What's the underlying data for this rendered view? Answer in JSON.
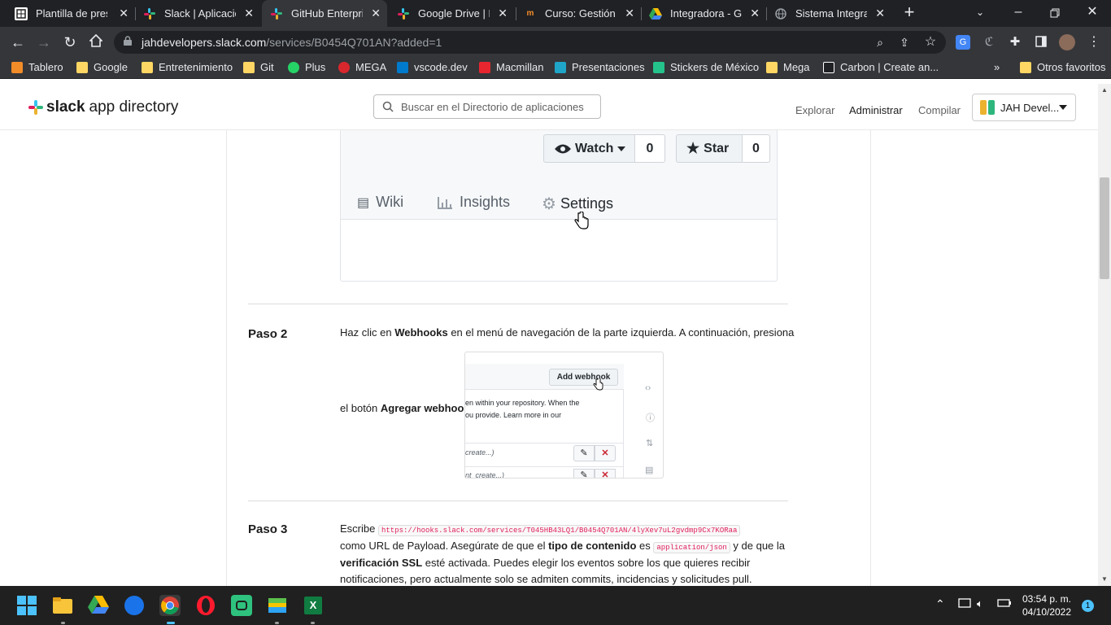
{
  "tabs": [
    {
      "title": "Plantilla de presu",
      "icon": "sheets-icon",
      "color": "#ffffff"
    },
    {
      "title": "Slack | Aplicacion",
      "icon": "slack-icon",
      "color": "#e01e5a"
    },
    {
      "title": "GitHub Enterprise",
      "icon": "slack-icon",
      "color": "#36c5f0"
    },
    {
      "title": "Google Drive | Di",
      "icon": "slack-icon",
      "color": "#ecb22e"
    },
    {
      "title": "Curso: Gestión de",
      "icon": "course-icon",
      "color": "#f28c28"
    },
    {
      "title": "Integradora - Go",
      "icon": "drive-icon",
      "color": "#34a853"
    },
    {
      "title": "Sistema Integral",
      "icon": "globe-icon",
      "color": "#9aa0a6"
    }
  ],
  "address": {
    "domain": "jahdevelopers.slack.com",
    "path": "/services/B0454Q701AN?added=1"
  },
  "bookmarks": [
    {
      "label": "Tablero",
      "color": "#f28c28"
    },
    {
      "label": "Google",
      "color": "#fdd663"
    },
    {
      "label": "Entretenimiento",
      "color": "#fdd663"
    },
    {
      "label": "Git",
      "color": "#fdd663"
    },
    {
      "label": "Plus",
      "color": "#25d366"
    },
    {
      "label": "MEGA",
      "color": "#d9272e"
    },
    {
      "label": "vscode.dev",
      "color": "#007acc"
    },
    {
      "label": "Macmillan",
      "color": "#e8262f"
    },
    {
      "label": "Presentaciones",
      "color": "#1fa5c8"
    },
    {
      "label": "Stickers de México",
      "color": "#24c38b"
    },
    {
      "label": "Mega",
      "color": "#fdd663"
    },
    {
      "label": "Carbon | Create an...",
      "color": "#ffffff"
    }
  ],
  "other_bookmarks": "Otros favoritos",
  "site": {
    "logo_bold": "slack",
    "logo_rest": "app directory",
    "search_placeholder": "Buscar en el Directorio de aplicaciones",
    "nav": [
      "Explorar",
      "Administrar",
      "Compilar"
    ],
    "workspace": "JAH Devel..."
  },
  "github": {
    "watch_label": "Watch",
    "watch_count": "0",
    "star_label": "Star",
    "star_count": "0",
    "tabs": [
      "Wiki",
      "Insights",
      "Settings"
    ]
  },
  "step2": {
    "label": "Paso 2",
    "t1": "Haz clic en ",
    "b1": "Webhooks",
    "t2": " en el menú de navegación de la parte izquierda. A continuación, presiona",
    "t3": "el botón ",
    "b2": "Agregar webhook",
    "t4": ".",
    "shot_button": "Add webhook",
    "shot_line1": "en within your repository. When the",
    "shot_line2": "ou provide. Learn more in our",
    "shot_row1": "create...)",
    "shot_row2": "nt_create...)"
  },
  "step3": {
    "label": "Paso 3",
    "t1": "Escribe ",
    "code1": "https://hooks.slack.com/services/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",
    "t2": "como URL de Payload. Asegúrate de que el ",
    "b1": "tipo de contenido",
    "t3": " es ",
    "code2": "application/json",
    "t4": " y de que la",
    "b2": "verificación SSL",
    "t5": " esté activada. Puedes elegir los eventos sobre los que quieres recibir",
    "t6": "notificaciones, pero actualmente solo se admiten commits, incidencias y solicitudes pull."
  },
  "tray": {
    "time": "03:54 p. m.",
    "date": "04/10/2022",
    "notifications": "1"
  }
}
